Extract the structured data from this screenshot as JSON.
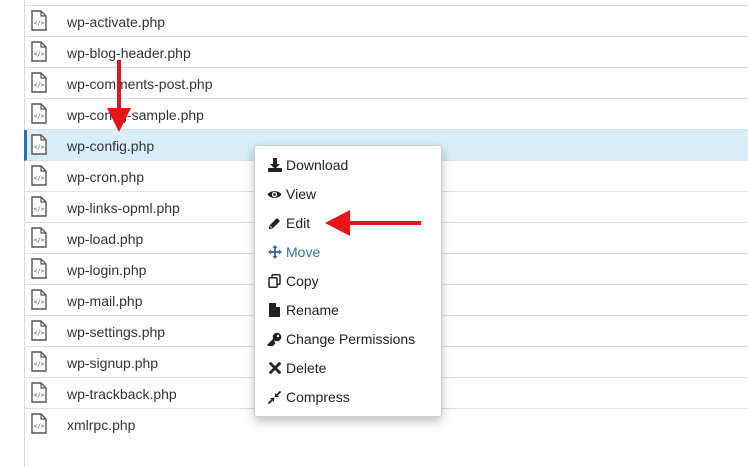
{
  "files": [
    {
      "name": "wp-activate.php",
      "selected": false
    },
    {
      "name": "wp-blog-header.php",
      "selected": false
    },
    {
      "name": "wp-comments-post.php",
      "selected": false
    },
    {
      "name": "wp-config-sample.php",
      "selected": false
    },
    {
      "name": "wp-config.php",
      "selected": true
    },
    {
      "name": "wp-cron.php",
      "selected": false
    },
    {
      "name": "wp-links-opml.php",
      "selected": false
    },
    {
      "name": "wp-load.php",
      "selected": false
    },
    {
      "name": "wp-login.php",
      "selected": false
    },
    {
      "name": "wp-mail.php",
      "selected": false
    },
    {
      "name": "wp-settings.php",
      "selected": false
    },
    {
      "name": "wp-signup.php",
      "selected": false
    },
    {
      "name": "wp-trackback.php",
      "selected": false
    },
    {
      "name": "xmlrpc.php",
      "selected": false
    }
  ],
  "context_menu": {
    "items": [
      {
        "label": "Download",
        "icon": "download-icon"
      },
      {
        "label": "View",
        "icon": "eye-icon"
      },
      {
        "label": "Edit",
        "icon": "pencil-icon"
      },
      {
        "label": "Move",
        "icon": "move-icon"
      },
      {
        "label": "Copy",
        "icon": "copy-icon"
      },
      {
        "label": "Rename",
        "icon": "file-icon"
      },
      {
        "label": "Change Permissions",
        "icon": "key-icon"
      },
      {
        "label": "Delete",
        "icon": "close-icon"
      },
      {
        "label": "Compress",
        "icon": "compress-icon"
      }
    ]
  },
  "colors": {
    "selected_row_bg": "#d9edf7",
    "annotation_arrow": "#e8141b",
    "move_item": "#3a6ea5"
  }
}
